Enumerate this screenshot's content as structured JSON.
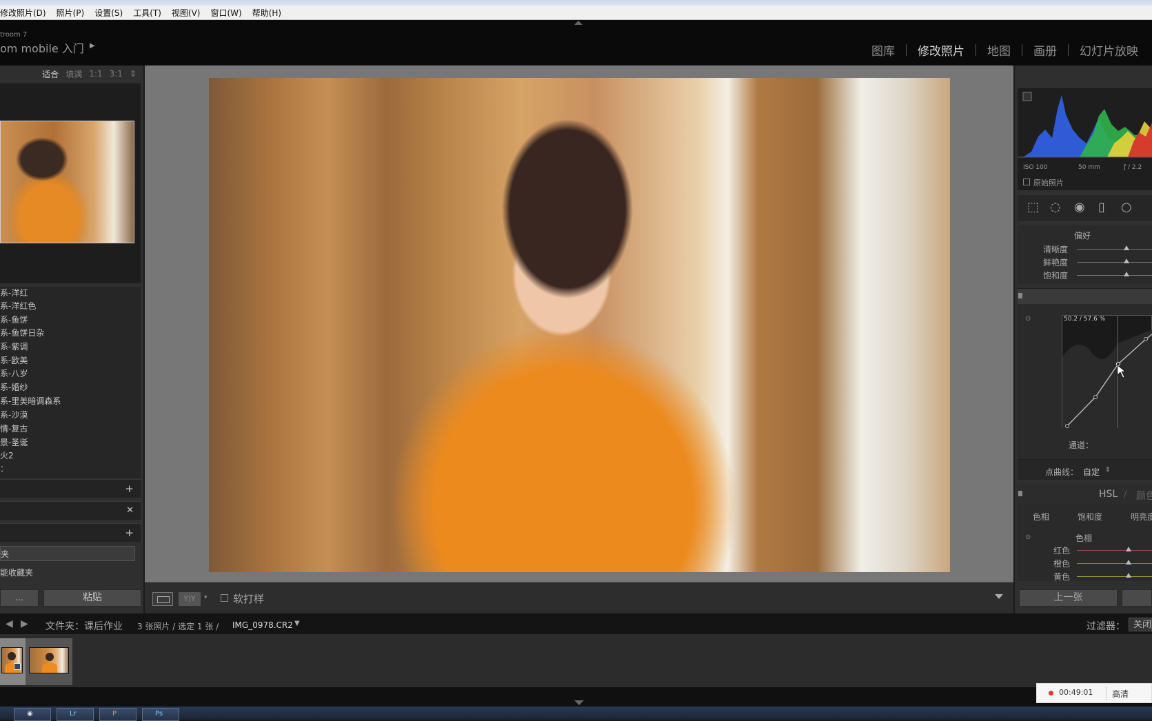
{
  "menubar": {
    "items": [
      "修改照片(D)",
      "照片(P)",
      "设置(S)",
      "工具(T)",
      "视图(V)",
      "窗口(W)",
      "帮助(H)"
    ]
  },
  "identity": {
    "line1": "troom 7",
    "line2": "om mobile 入门"
  },
  "modules": [
    {
      "label": "图库",
      "active": false
    },
    {
      "label": "修改照片",
      "active": true
    },
    {
      "label": "地图",
      "active": false
    },
    {
      "label": "画册",
      "active": false
    },
    {
      "label": "幻灯片放映",
      "active": false
    }
  ],
  "navigator": {
    "zoom": [
      "适合",
      "填满",
      "1:1",
      "3:1"
    ],
    "active_zoom": "适合"
  },
  "presets": [
    "系-洋红",
    "系-洋红色",
    "系-鱼饼",
    "系-鱼饼日杂",
    "系-紫调",
    "系-欧美",
    "系-八岁",
    "系-婚纱",
    "系-里美暗调森系",
    "系-沙漠",
    "情-复古",
    "景-圣诞",
    "火2",
    "："
  ],
  "left_panel": {
    "collection_selected": "夹",
    "collection_item": "能收藏夹",
    "copy_button": "...",
    "paste_button": "粘贴"
  },
  "toolbar": {
    "yy_label": "Y|Y",
    "soft_proof_label": "软打样"
  },
  "right_panel": {
    "histogram_info": {
      "iso": "ISO 100",
      "focal": "50 mm",
      "aperture": "ƒ / 2.2"
    },
    "original_photo_label": "原始照片",
    "presence": {
      "title": "偏好",
      "sliders": [
        {
          "label": "清晰度",
          "value": 0
        },
        {
          "label": "鲜艳度",
          "value": 0
        },
        {
          "label": "饱和度",
          "value": 0
        }
      ]
    },
    "tone_curve": {
      "readout": "50.2 / 57.6 %",
      "channel_label": "通道：",
      "point_curve_label": "点曲线：",
      "point_curve_value": "自定"
    },
    "hsl": {
      "title": "HSL",
      "title2": "颜色",
      "tabs": [
        "色相",
        "饱和度",
        "明亮度"
      ],
      "section": "色相",
      "sliders": [
        {
          "label": "红色",
          "value": 0
        },
        {
          "label": "橙色",
          "value": 0
        },
        {
          "label": "黄色",
          "value": 0
        }
      ]
    },
    "prev_button": "上一张"
  },
  "filmstrip": {
    "folder": "文件夹：课后作业",
    "count": "3 张照片 / 选定 1 张 /",
    "filename": "IMG_0978.CR2",
    "filter_label": "过滤器：",
    "filter_value": "关闭"
  },
  "recorder": {
    "time": "00:49:01",
    "quality": "高清"
  },
  "colors": {
    "panel": "#2f2f2f",
    "background": "#777777",
    "accent_orange": "#ec8a1e"
  }
}
